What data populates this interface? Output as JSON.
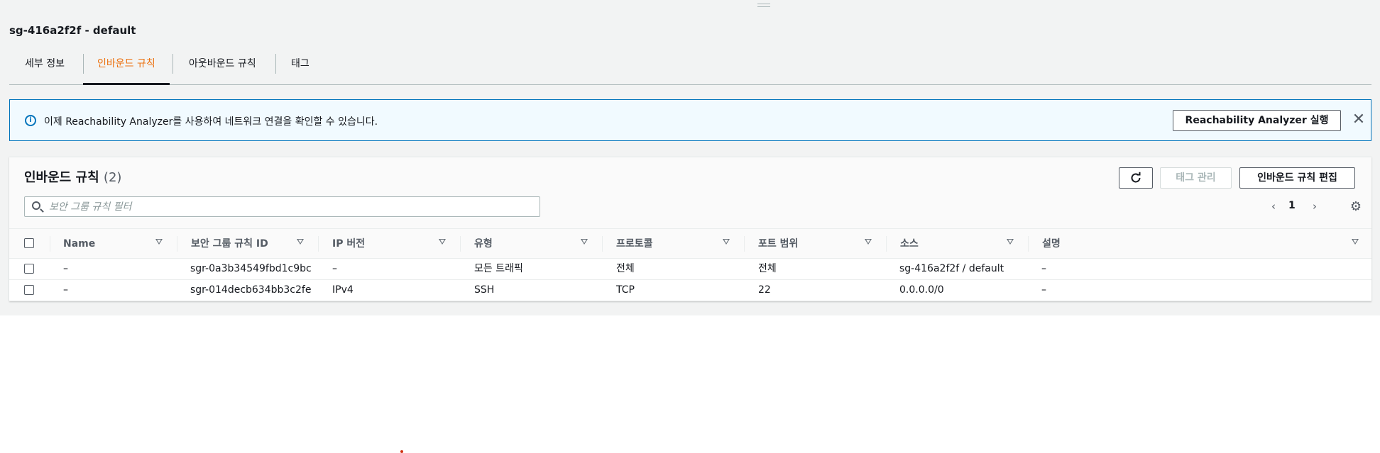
{
  "security_group": {
    "title": "sg-416a2f2f - default"
  },
  "tabs": [
    {
      "label": "세부 정보",
      "active": false
    },
    {
      "label": "인바운드 규칙",
      "active": true
    },
    {
      "label": "아웃바운드 규칙",
      "active": false
    },
    {
      "label": "태그",
      "active": false
    }
  ],
  "banner": {
    "icon": "info-icon",
    "message": "이제 Reachability Analyzer를 사용하여 네트워크 연결을 확인할 수 있습니다.",
    "button_label": "Reachability Analyzer 실행",
    "close_symbol": "✕"
  },
  "panel": {
    "title": "인바운드 규칙",
    "count": "(2)",
    "refresh_icon": "refresh-icon",
    "manage_tags_label": "태그 관리",
    "edit_rules_label": "인바운드 규칙 편집",
    "search_placeholder": "보안 그룹 규칙 필터",
    "search_value": "",
    "pagination": {
      "prev": "‹",
      "page": "1",
      "next": "›"
    },
    "settings_icon": "gear-icon"
  },
  "table": {
    "columns": [
      "Name",
      "보안 그룹 규칙 ID",
      "IP 버전",
      "유형",
      "프로토콜",
      "포트 범위",
      "소스",
      "설명"
    ],
    "rows": [
      {
        "name": "–",
        "rule_id": "sgr-0a3b34549fbd1c9bc",
        "ip_version": "–",
        "type": "모든 트래픽",
        "protocol": "전체",
        "port_range": "전체",
        "source": "sg-416a2f2f / default",
        "description": "–"
      },
      {
        "name": "–",
        "rule_id": "sgr-014decb634bb3c2fe",
        "ip_version": "IPv4",
        "type": "SSH",
        "protocol": "TCP",
        "port_range": "22",
        "source": "0.0.0.0/0",
        "description": "–"
      }
    ]
  },
  "colors": {
    "accent": "#ec7211",
    "info_blue": "#0073bb",
    "banner_bg": "#f1faff",
    "text": "#16191f",
    "muted": "#545b64"
  }
}
